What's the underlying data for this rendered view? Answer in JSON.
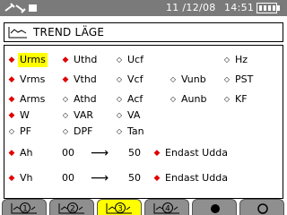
{
  "status": {
    "date": "11 /12/08",
    "time": "14:51"
  },
  "title": "TREND LÄGE",
  "params": [
    {
      "label": "Urms",
      "selected": true,
      "highlight": true
    },
    {
      "label": "Uthd",
      "selected": true
    },
    {
      "label": "Ucf",
      "selected": false
    },
    {
      "label": "Hz",
      "selected": false
    },
    {
      "label": "Vrms",
      "selected": true
    },
    {
      "label": "Vthd",
      "selected": true
    },
    {
      "label": "Vcf",
      "selected": false
    },
    {
      "label": "Vunb",
      "selected": false
    },
    {
      "label": "PST",
      "selected": false
    },
    {
      "label": "Arms",
      "selected": true
    },
    {
      "label": "Athd",
      "selected": false
    },
    {
      "label": "Acf",
      "selected": false
    },
    {
      "label": "Aunb",
      "selected": false
    },
    {
      "label": "KF",
      "selected": false
    },
    {
      "label": "W",
      "selected": true
    },
    {
      "label": "VAR",
      "selected": false
    },
    {
      "label": "VA",
      "selected": false
    },
    {
      "label": "PF",
      "selected": false
    },
    {
      "label": "DPF",
      "selected": false
    },
    {
      "label": "Tan",
      "selected": false
    }
  ],
  "harmonics": [
    {
      "label": "Ah",
      "from": "00",
      "arrow": "⟶",
      "to": "50",
      "option": "Endast Udda"
    },
    {
      "label": "Vh",
      "from": "00",
      "arrow": "⟶",
      "to": "50",
      "option": "Endast Udda"
    }
  ],
  "tabs": [
    {
      "name": "tab-1",
      "number": "1",
      "active": false
    },
    {
      "name": "tab-2",
      "number": "2",
      "active": false
    },
    {
      "name": "tab-3",
      "number": "3",
      "active": true
    },
    {
      "name": "tab-4",
      "number": "4",
      "active": false
    },
    {
      "name": "tab-dot-filled",
      "number": "",
      "active": false
    },
    {
      "name": "tab-dot-empty",
      "number": "",
      "active": false
    }
  ],
  "colors": {
    "selected_mark": "#e00000",
    "highlight": "#ffff00",
    "statusbar": "#7a7a7a",
    "tab": "#8f8f8f"
  }
}
